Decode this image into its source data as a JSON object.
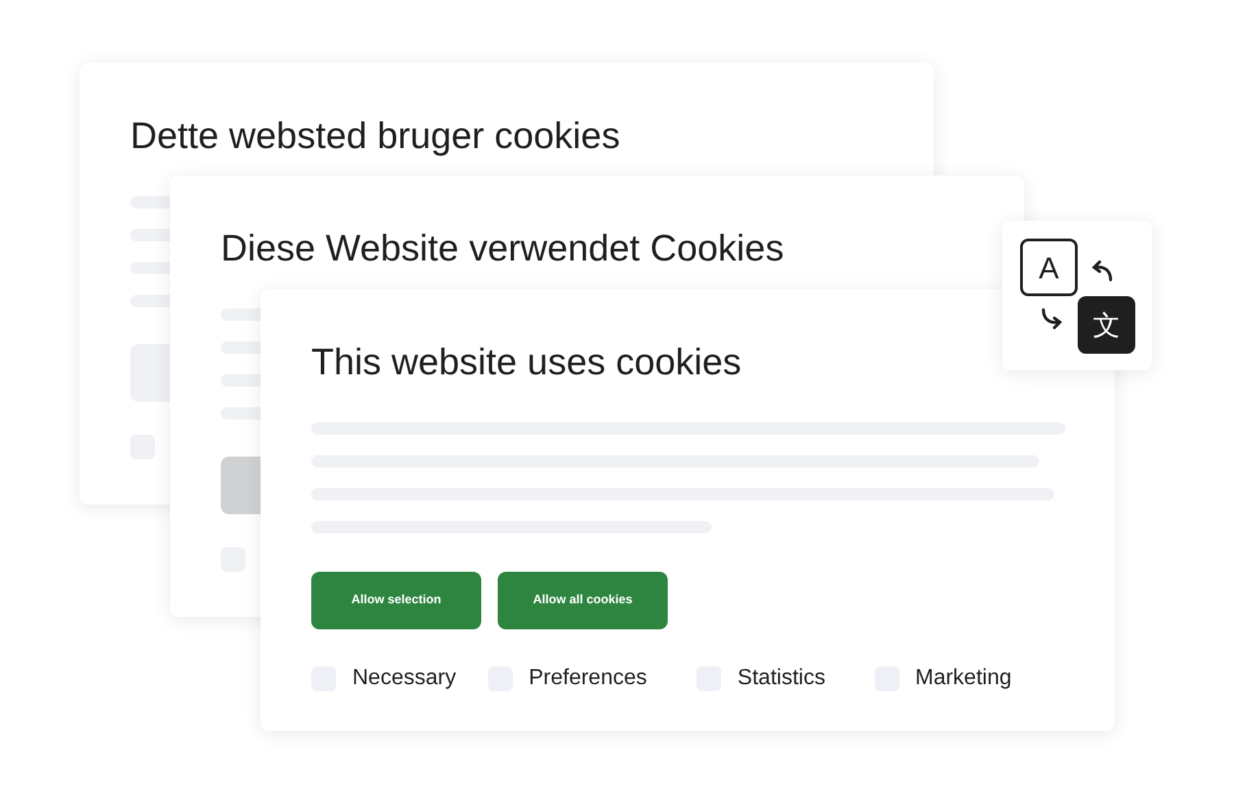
{
  "banners": [
    {
      "title": "Dette websted bruger cookies"
    },
    {
      "title": "Diese Website verwendet Cookies"
    },
    {
      "title": "This website uses cookies",
      "buttons": [
        "Allow selection",
        "Allow all cookies"
      ],
      "options": [
        {
          "label": "Necessary",
          "checked": false
        },
        {
          "label": "Preferences",
          "checked": false
        },
        {
          "label": "Statistics",
          "checked": false
        },
        {
          "label": "Marketing",
          "checked": false
        }
      ]
    }
  ],
  "translate_widget": {
    "source_letter": "A",
    "target_letter": "文"
  }
}
